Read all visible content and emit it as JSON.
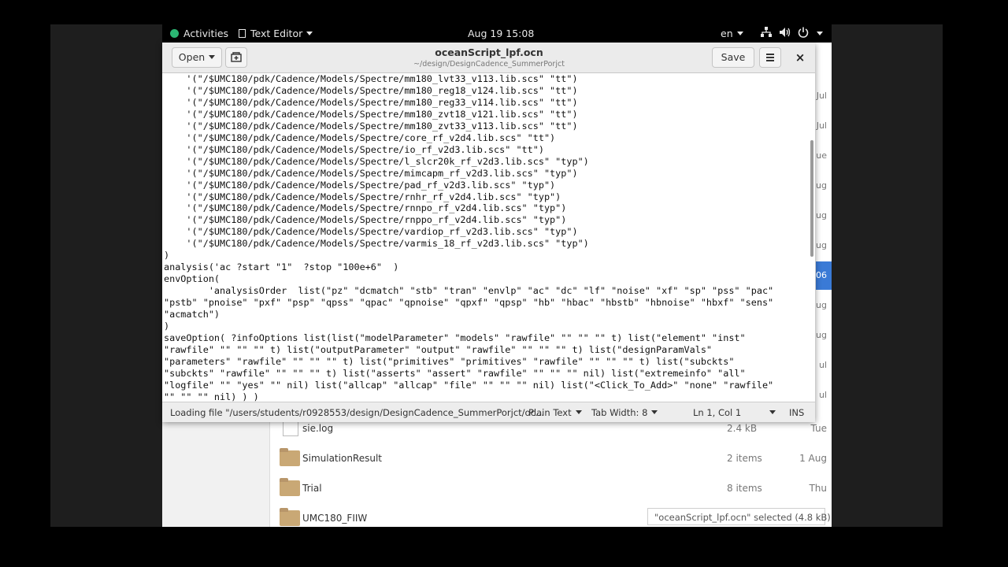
{
  "topbar": {
    "activities": "Activities",
    "app_name": "Text Editor",
    "clock": "Aug 19 15:08",
    "language": "en"
  },
  "editor": {
    "title": "oceanScript_lpf.ocn",
    "path": "~/design/DesignCadence_SummerPorjct",
    "open_label": "Open",
    "save_label": "Save",
    "close_glyph": "×"
  },
  "code_lines": [
    "    '(\"/$UMC180/pdk/Cadence/Models/Spectre/mm180_lvt33_v113.lib.scs\" \"tt\")",
    "    '(\"/$UMC180/pdk/Cadence/Models/Spectre/mm180_reg18_v124.lib.scs\" \"tt\")",
    "    '(\"/$UMC180/pdk/Cadence/Models/Spectre/mm180_reg33_v114.lib.scs\" \"tt\")",
    "    '(\"/$UMC180/pdk/Cadence/Models/Spectre/mm180_zvt18_v121.lib.scs\" \"tt\")",
    "    '(\"/$UMC180/pdk/Cadence/Models/Spectre/mm180_zvt33_v113.lib.scs\" \"tt\")",
    "    '(\"/$UMC180/pdk/Cadence/Models/Spectre/core_rf_v2d4.lib.scs\" \"tt\")",
    "    '(\"/$UMC180/pdk/Cadence/Models/Spectre/io_rf_v2d3.lib.scs\" \"tt\")",
    "    '(\"/$UMC180/pdk/Cadence/Models/Spectre/l_slcr20k_rf_v2d3.lib.scs\" \"typ\")",
    "    '(\"/$UMC180/pdk/Cadence/Models/Spectre/mimcapm_rf_v2d3.lib.scs\" \"typ\")",
    "    '(\"/$UMC180/pdk/Cadence/Models/Spectre/pad_rf_v2d3.lib.scs\" \"typ\")",
    "    '(\"/$UMC180/pdk/Cadence/Models/Spectre/rnhr_rf_v2d4.lib.scs\" \"typ\")",
    "    '(\"/$UMC180/pdk/Cadence/Models/Spectre/rnnpo_rf_v2d4.lib.scs\" \"typ\")",
    "    '(\"/$UMC180/pdk/Cadence/Models/Spectre/rnppo_rf_v2d4.lib.scs\" \"typ\")",
    "    '(\"/$UMC180/pdk/Cadence/Models/Spectre/vardiop_rf_v2d3.lib.scs\" \"typ\")",
    "    '(\"/$UMC180/pdk/Cadence/Models/Spectre/varmis_18_rf_v2d3.lib.scs\" \"typ\")",
    ")",
    "analysis('ac ?start \"1\"  ?stop \"100e+6\"  )",
    "envOption(",
    "        'analysisOrder  list(\"pz\" \"dcmatch\" \"stb\" \"tran\" \"envlp\" \"ac\" \"dc\" \"lf\" \"noise\" \"xf\" \"sp\" \"pss\" \"pac\"",
    "\"pstb\" \"pnoise\" \"pxf\" \"psp\" \"qpss\" \"qpac\" \"qpnoise\" \"qpxf\" \"qpsp\" \"hb\" \"hbac\" \"hbstb\" \"hbnoise\" \"hbxf\" \"sens\"",
    "\"acmatch\")",
    ")",
    "saveOption( ?infoOptions list(list(\"modelParameter\" \"models\" \"rawfile\" \"\" \"\" \"\" t) list(\"element\" \"inst\"",
    "\"rawfile\" \"\" \"\" \"\" t) list(\"outputParameter\" \"output\" \"rawfile\" \"\" \"\" \"\" t) list(\"designParamVals\"",
    "\"parameters\" \"rawfile\" \"\" \"\" \"\" t) list(\"primitives\" \"primitives\" \"rawfile\" \"\" \"\" \"\" t) list(\"subckts\"",
    "\"subckts\" \"rawfile\" \"\" \"\" \"\" t) list(\"asserts\" \"assert\" \"rawfile\" \"\" \"\" \"\" nil) list(\"extremeinfo\" \"all\"",
    "\"logfile\" \"\" \"yes\" \"\" nil) list(\"allcap\" \"allcap\" \"file\" \"\" \"\" \"\" nil) list(\"<Click_To_Add>\" \"none\" \"rawfile\"",
    "\"\" \"\" \"\" nil) ) )"
  ],
  "statusbar": {
    "message": "Loading file \"/users/students/r0928553/design/DesignCadence_SummerPorjct/oc...",
    "language": "Plain Text",
    "tab_width": "Tab Width: 8",
    "position": "Ln 1, Col 1",
    "mode": "INS"
  },
  "filemanager": {
    "side_dates": [
      "Jul",
      "Jul",
      "ue",
      "ug",
      "ug",
      "ug",
      "06",
      "ug",
      "ug",
      "ul",
      "ul"
    ],
    "rows": [
      {
        "name": "sie.log",
        "size": "2.4 kB",
        "when": "Tue",
        "kind": "file"
      },
      {
        "name": "SimulationResult",
        "size": "2 items",
        "when": "1 Aug",
        "kind": "folder"
      },
      {
        "name": "Trial",
        "size": "8 items",
        "when": "Thu",
        "kind": "folder"
      },
      {
        "name": "UMC180_FIIW",
        "size": "",
        "when": "",
        "kind": "folder"
      }
    ],
    "selection_info": "\"oceanScript_lpf.ocn\" selected  (4.8 kB)"
  }
}
